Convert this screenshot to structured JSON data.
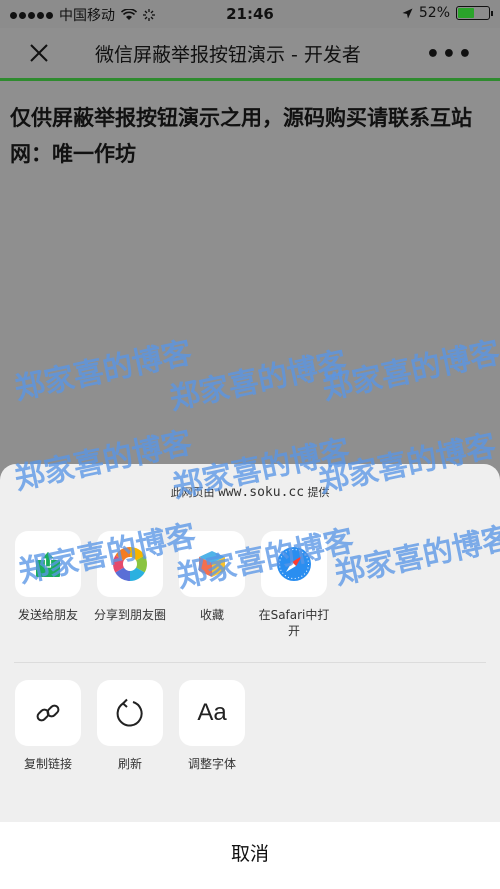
{
  "status_bar": {
    "carrier": "中国移动",
    "time": "21:46",
    "battery": "52%",
    "battery_level": 0.52
  },
  "nav": {
    "title": "微信屏蔽举报按钮演示 - 开发者",
    "more": "•••"
  },
  "content": {
    "text": "仅供屏蔽举报按钮演示之用，源码购买请联系互站网：唯一作坊"
  },
  "watermark": {
    "text": "郑家喜的博客"
  },
  "sheet": {
    "provider_prefix": "此网页由",
    "provider_domain": "www.soku.cc",
    "provider_suffix": "提供",
    "row1": [
      {
        "label": "发送给朋友",
        "icon": "send-to-friend-icon"
      },
      {
        "label": "分享到朋友圈",
        "icon": "moments-icon"
      },
      {
        "label": "收藏",
        "icon": "favorite-icon"
      },
      {
        "label": "在Safari中打开",
        "icon": "safari-icon"
      }
    ],
    "row2": [
      {
        "label": "复制链接",
        "icon": "link-icon"
      },
      {
        "label": "刷新",
        "icon": "refresh-icon"
      },
      {
        "label": "调整字体",
        "icon": "font-icon",
        "glyph": "Aa"
      }
    ],
    "cancel": "取消"
  }
}
